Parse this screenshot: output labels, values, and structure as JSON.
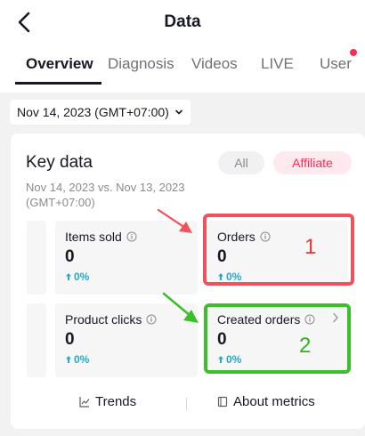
{
  "header": {
    "title": "Data"
  },
  "tabs": [
    {
      "label": "Overview",
      "active": true
    },
    {
      "label": "Diagnosis"
    },
    {
      "label": "Videos"
    },
    {
      "label": "LIVE"
    },
    {
      "label": "User",
      "has_dot": true
    }
  ],
  "date_filter": {
    "label": "Nov 14, 2023 (GMT+07:00)"
  },
  "key_data": {
    "title": "Key data",
    "comparison": "Nov 14, 2023 vs. Nov 13, 2023 (GMT+07:00)",
    "filter_all": "All",
    "filter_affiliate": "Affiliate",
    "metrics": {
      "items_sold": {
        "label": "Items sold",
        "value": "0",
        "delta": "0%"
      },
      "orders": {
        "label": "Orders",
        "value": "0",
        "delta": "0%"
      },
      "product_clicks": {
        "label": "Product clicks",
        "value": "0",
        "delta": "0%"
      },
      "created_orders": {
        "label": "Created orders",
        "value": "0",
        "delta": "0%"
      }
    },
    "annotations": {
      "red": "1",
      "green": "2"
    },
    "footer": {
      "trends": "Trends",
      "about": "About metrics"
    }
  },
  "colors": {
    "accent": "#fe2c55",
    "delta": "#25a9c4",
    "annotation_red": "#f0515b",
    "annotation_green": "#3bc02b"
  }
}
